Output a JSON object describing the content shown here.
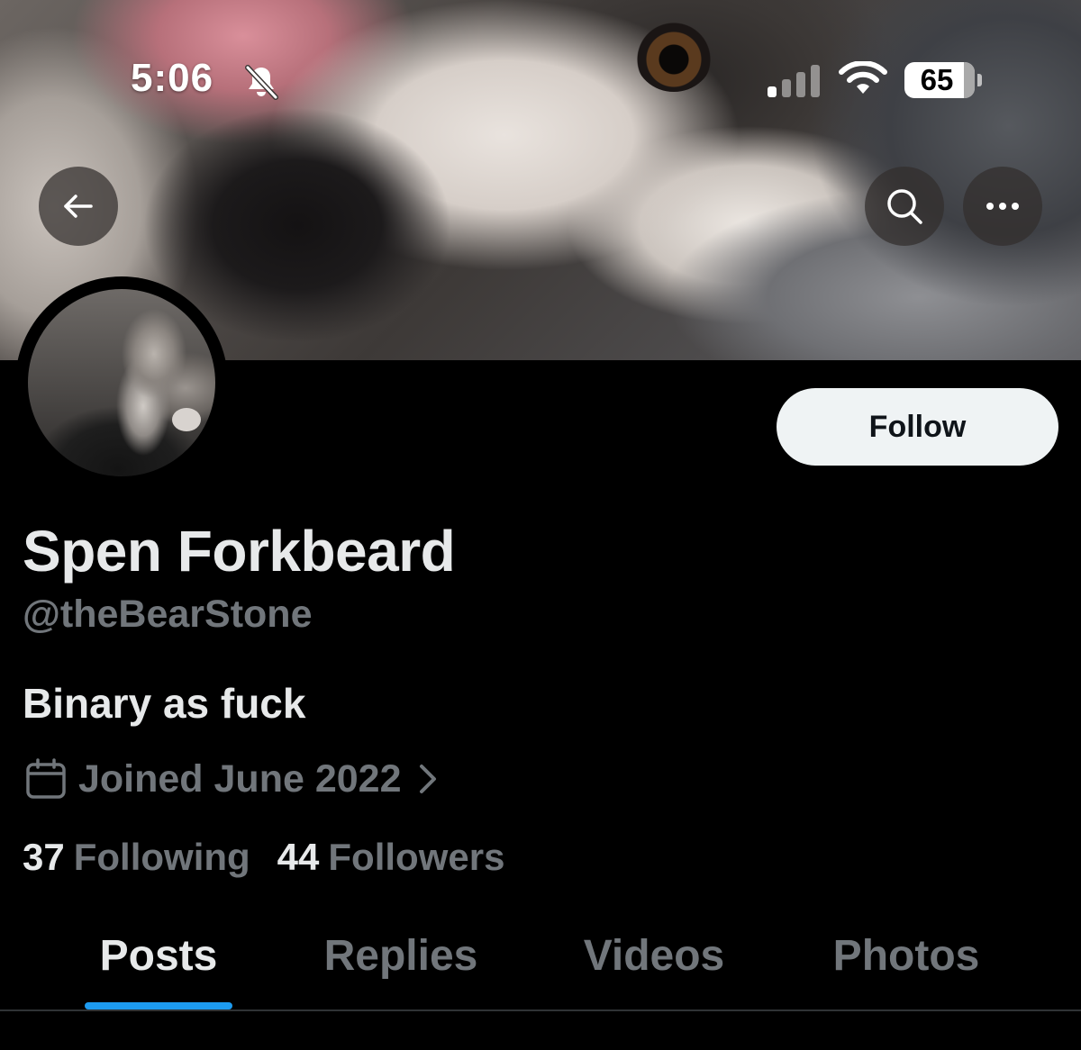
{
  "status_bar": {
    "time": "5:06",
    "battery_level": "65",
    "icons": [
      "bell-slash-icon",
      "cellular-signal-icon",
      "wifi-icon",
      "battery-icon"
    ]
  },
  "nav": {
    "icons": [
      "arrow-left-icon",
      "search-icon",
      "more-horizontal-icon"
    ]
  },
  "profile": {
    "display_name": "Spen Forkbeard",
    "handle": "@theBearStone",
    "bio": "Binary as fuck",
    "joined": "Joined June 2022",
    "follow_label": "Follow",
    "following_count": "37",
    "following_label": "Following",
    "followers_count": "44",
    "followers_label": "Followers"
  },
  "tabs": [
    {
      "label": "Posts",
      "active": true
    },
    {
      "label": "Replies",
      "active": false
    },
    {
      "label": "Videos",
      "active": false
    },
    {
      "label": "Photos",
      "active": false
    }
  ],
  "colors": {
    "background": "#000000",
    "primary_text": "#e7e9ea",
    "secondary_text": "#71767b",
    "accent": "#1d9bf0",
    "follow_button_bg": "#eff3f4"
  }
}
